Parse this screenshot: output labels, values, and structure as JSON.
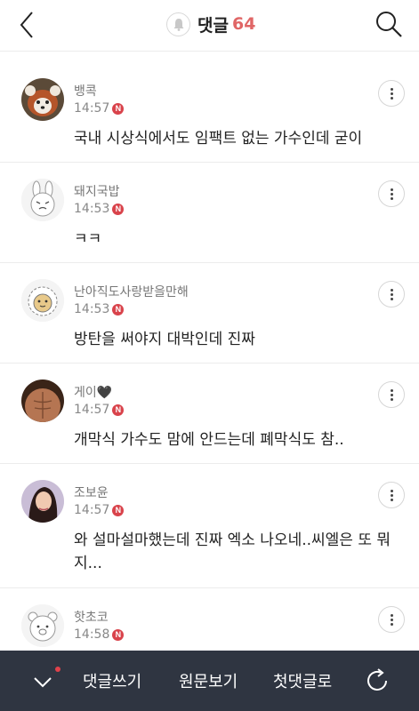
{
  "header": {
    "title": "댓글",
    "count": "64",
    "icons": {
      "back": "chevron-left-icon",
      "bell": "bell-icon",
      "search": "search-icon"
    }
  },
  "comments": [
    {
      "nickname": "뱅콕",
      "time": "14:57",
      "badge": "N",
      "text": "국내 시상식에서도 임팩트 없는 가수인데 굳이",
      "avatar": "red-panda"
    },
    {
      "nickname": "돼지국밥",
      "time": "14:53",
      "badge": "N",
      "text": "ㅋㅋ",
      "avatar": "rabbit-character"
    },
    {
      "nickname": "난아직도사랑받을만해",
      "time": "14:53",
      "badge": "N",
      "text": "방탄을 써야지 대박인데 진짜",
      "avatar": "lion-character"
    },
    {
      "nickname": "게이🖤",
      "time": "14:57",
      "badge": "N",
      "text": "개막식 가수도 맘에 안드는데 폐막식도 참..",
      "avatar": "torso-photo"
    },
    {
      "nickname": "조보윤",
      "time": "14:57",
      "badge": "N",
      "text": "와 설마설마했는데 진짜 엑소 나오네..씨엘은 또 뭐지...",
      "avatar": "woman-photo"
    },
    {
      "nickname": "핫초코",
      "time": "14:58",
      "badge": "N",
      "text": "",
      "avatar": "bear-character"
    }
  ],
  "bottom_bar": {
    "write_label": "댓글쓰기",
    "original_label": "원문보기",
    "first_label": "첫댓글로",
    "icons": {
      "collapse": "chevron-down-icon",
      "refresh": "refresh-icon"
    }
  },
  "colors": {
    "accent": "#e06666",
    "badge": "#d9434b",
    "bar_bg": "#2f3541"
  }
}
